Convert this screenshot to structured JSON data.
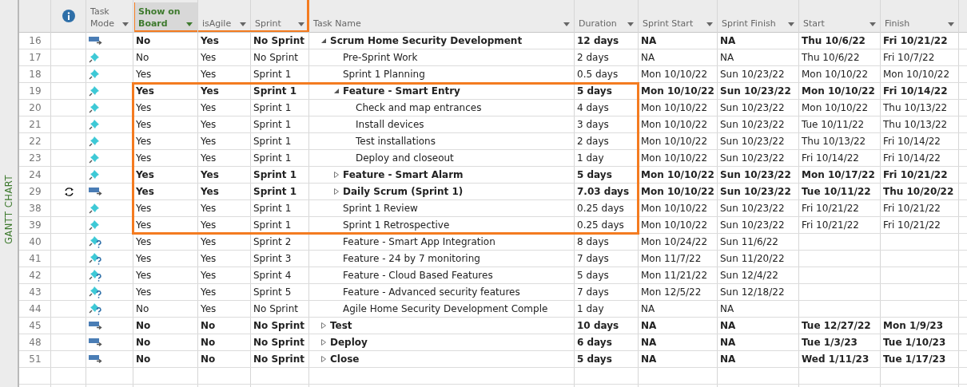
{
  "view_label": "GANTT CHART",
  "columns": [
    {
      "kind": "info"
    },
    {
      "kind": "field",
      "label": "Task Mode",
      "selected": false,
      "highlight": false
    },
    {
      "kind": "field",
      "label": "Show on Board",
      "selected": true,
      "highlight": true
    },
    {
      "kind": "field",
      "label": "isAgile",
      "selected": false,
      "highlight": true
    },
    {
      "kind": "field",
      "label": "Sprint",
      "selected": false,
      "highlight": true
    },
    {
      "kind": "field",
      "label": "Task Name",
      "selected": false,
      "highlight": false
    },
    {
      "kind": "field",
      "label": "Duration",
      "selected": false,
      "highlight": false
    },
    {
      "kind": "field",
      "label": "Sprint Start",
      "selected": false,
      "highlight": false
    },
    {
      "kind": "field",
      "label": "Sprint Finish",
      "selected": false,
      "highlight": false
    },
    {
      "kind": "field",
      "label": "Start",
      "selected": false,
      "highlight": false
    },
    {
      "kind": "field",
      "label": "Finish",
      "selected": false,
      "highlight": false
    }
  ],
  "tasks": [
    {
      "id": "16",
      "kind": "auto",
      "summary": true,
      "expanded": true,
      "highlight": false,
      "show_on_board": "No",
      "is_agile": "Yes",
      "sprint": "No Sprint",
      "name": "Scrum Home Security Development",
      "duration": "12 days",
      "sprint_start": "NA",
      "sprint_finish": "NA",
      "start": "Thu 10/6/22",
      "finish": "Fri 10/21/22",
      "children": [
        {
          "id": "17",
          "kind": "manual",
          "summary": false,
          "highlight": false,
          "show_on_board": "No",
          "is_agile": "Yes",
          "sprint": "No Sprint",
          "name": "Pre-Sprint Work",
          "duration": "2 days",
          "sprint_start": "NA",
          "sprint_finish": "NA",
          "start": "Thu 10/6/22",
          "finish": "Fri 10/7/22"
        },
        {
          "id": "18",
          "kind": "manual",
          "summary": false,
          "highlight": false,
          "show_on_board": "Yes",
          "is_agile": "Yes",
          "sprint": "Sprint 1",
          "name": "Sprint 1 Planning",
          "duration": "0.5 days",
          "sprint_start": "Mon 10/10/22",
          "sprint_finish": "Sun 10/23/22",
          "start": "Mon 10/10/22",
          "finish": "Mon 10/10/22"
        },
        {
          "id": "19",
          "kind": "manual",
          "summary": true,
          "expanded": true,
          "highlight": true,
          "show_on_board": "Yes",
          "is_agile": "Yes",
          "sprint": "Sprint 1",
          "name": "Feature - Smart Entry",
          "duration": "5 days",
          "sprint_start": "Mon 10/10/22",
          "sprint_finish": "Sun 10/23/22",
          "start": "Mon 10/10/22",
          "finish": "Fri 10/14/22",
          "children": [
            {
              "id": "20",
              "kind": "manual",
              "summary": false,
              "highlight": true,
              "show_on_board": "Yes",
              "is_agile": "Yes",
              "sprint": "Sprint 1",
              "name": "Check and map entrances",
              "duration": "4 days",
              "sprint_start": "Mon 10/10/22",
              "sprint_finish": "Sun 10/23/22",
              "start": "Mon 10/10/22",
              "finish": "Thu 10/13/22"
            },
            {
              "id": "21",
              "kind": "manual",
              "summary": false,
              "highlight": true,
              "show_on_board": "Yes",
              "is_agile": "Yes",
              "sprint": "Sprint 1",
              "name": "Install devices",
              "duration": "3 days",
              "sprint_start": "Mon 10/10/22",
              "sprint_finish": "Sun 10/23/22",
              "start": "Tue 10/11/22",
              "finish": "Thu 10/13/22"
            },
            {
              "id": "22",
              "kind": "manual",
              "summary": false,
              "highlight": true,
              "show_on_board": "Yes",
              "is_agile": "Yes",
              "sprint": "Sprint 1",
              "name": "Test installations",
              "duration": "2 days",
              "sprint_start": "Mon 10/10/22",
              "sprint_finish": "Sun 10/23/22",
              "start": "Thu 10/13/22",
              "finish": "Fri 10/14/22"
            },
            {
              "id": "23",
              "kind": "manual",
              "summary": false,
              "highlight": true,
              "show_on_board": "Yes",
              "is_agile": "Yes",
              "sprint": "Sprint 1",
              "name": "Deploy and closeout",
              "duration": "1 day",
              "sprint_start": "Mon 10/10/22",
              "sprint_finish": "Sun 10/23/22",
              "start": "Fri 10/14/22",
              "finish": "Fri 10/14/22"
            }
          ]
        },
        {
          "id": "24",
          "kind": "manual",
          "summary": true,
          "expanded": false,
          "highlight": true,
          "show_on_board": "Yes",
          "is_agile": "Yes",
          "sprint": "Sprint 1",
          "name": "Feature - Smart Alarm",
          "duration": "5 days",
          "sprint_start": "Mon 10/10/22",
          "sprint_finish": "Sun 10/23/22",
          "start": "Mon 10/17/22",
          "finish": "Fri 10/21/22"
        },
        {
          "id": "29",
          "recurring": true,
          "kind": "auto",
          "summary": true,
          "expanded": false,
          "highlight": true,
          "show_on_board": "Yes",
          "is_agile": "Yes",
          "sprint": "Sprint 1",
          "name": "Daily Scrum (Sprint 1)",
          "duration": "7.03 days",
          "sprint_start": "Mon 10/10/22",
          "sprint_finish": "Sun 10/23/22",
          "start": "Tue 10/11/22",
          "finish": "Thu 10/20/22"
        },
        {
          "id": "38",
          "kind": "manual",
          "summary": false,
          "highlight": true,
          "show_on_board": "Yes",
          "is_agile": "Yes",
          "sprint": "Sprint 1",
          "name": "Sprint 1 Review",
          "duration": "0.25 days",
          "sprint_start": "Mon 10/10/22",
          "sprint_finish": "Sun 10/23/22",
          "start": "Fri 10/21/22",
          "finish": "Fri 10/21/22"
        },
        {
          "id": "39",
          "kind": "manual",
          "summary": false,
          "highlight": true,
          "show_on_board": "Yes",
          "is_agile": "Yes",
          "sprint": "Sprint 1",
          "name": "Sprint 1 Retrospective",
          "duration": "0.25 days",
          "sprint_start": "Mon 10/10/22",
          "sprint_finish": "Sun 10/23/22",
          "start": "Fri 10/21/22",
          "finish": "Fri 10/21/22"
        },
        {
          "id": "40",
          "kind": "estimated",
          "summary": false,
          "highlight": false,
          "show_on_board": "Yes",
          "is_agile": "Yes",
          "sprint": "Sprint 2",
          "name": "Feature - Smart App Integration",
          "duration": "8 days",
          "sprint_start": "Mon 10/24/22",
          "sprint_finish": "Sun 11/6/22"
        },
        {
          "id": "41",
          "kind": "estimated",
          "summary": false,
          "highlight": false,
          "show_on_board": "Yes",
          "is_agile": "Yes",
          "sprint": "Sprint 3",
          "name": "Feature - 24 by 7 monitoring",
          "duration": "7 days",
          "sprint_start": "Mon 11/7/22",
          "sprint_finish": "Sun 11/20/22"
        },
        {
          "id": "42",
          "kind": "estimated",
          "summary": false,
          "highlight": false,
          "show_on_board": "Yes",
          "is_agile": "Yes",
          "sprint": "Sprint 4",
          "name": "Feature - Cloud Based Features",
          "duration": "5 days",
          "sprint_start": "Mon 11/21/22",
          "sprint_finish": "Sun 12/4/22"
        },
        {
          "id": "43",
          "kind": "estimated",
          "summary": false,
          "highlight": false,
          "show_on_board": "Yes",
          "is_agile": "Yes",
          "sprint": "Sprint 5",
          "name": "Feature - Advanced security features",
          "duration": "7 days",
          "sprint_start": "Mon 12/5/22",
          "sprint_finish": "Sun 12/18/22"
        },
        {
          "id": "44",
          "kind": "estimated",
          "summary": false,
          "highlight": false,
          "show_on_board": "No",
          "is_agile": "Yes",
          "sprint": "No Sprint",
          "name": "Agile Home Security Development Comple",
          "duration": "1 day",
          "sprint_start": "NA",
          "sprint_finish": "NA"
        }
      ]
    },
    {
      "id": "45",
      "kind": "auto",
      "summary": true,
      "expanded": false,
      "highlight": false,
      "show_on_board": "No",
      "is_agile": "No",
      "sprint": "No Sprint",
      "name": "Test",
      "duration": "10 days",
      "sprint_start": "NA",
      "sprint_finish": "NA",
      "start": "Tue 12/27/22",
      "finish": "Mon 1/9/23"
    },
    {
      "id": "48",
      "kind": "auto",
      "summary": true,
      "expanded": false,
      "highlight": false,
      "show_on_board": "No",
      "is_agile": "No",
      "sprint": "No Sprint",
      "name": "Deploy",
      "duration": "6 days",
      "sprint_start": "NA",
      "sprint_finish": "NA",
      "start": "Tue 1/3/23",
      "finish": "Tue 1/10/23"
    },
    {
      "id": "51",
      "kind": "auto",
      "summary": true,
      "expanded": false,
      "highlight": false,
      "show_on_board": "No",
      "is_agile": "No",
      "sprint": "No Sprint",
      "name": "Close",
      "duration": "5 days",
      "sprint_start": "NA",
      "sprint_finish": "NA",
      "start": "Wed 1/11/23",
      "finish": "Tue 1/17/23"
    }
  ]
}
